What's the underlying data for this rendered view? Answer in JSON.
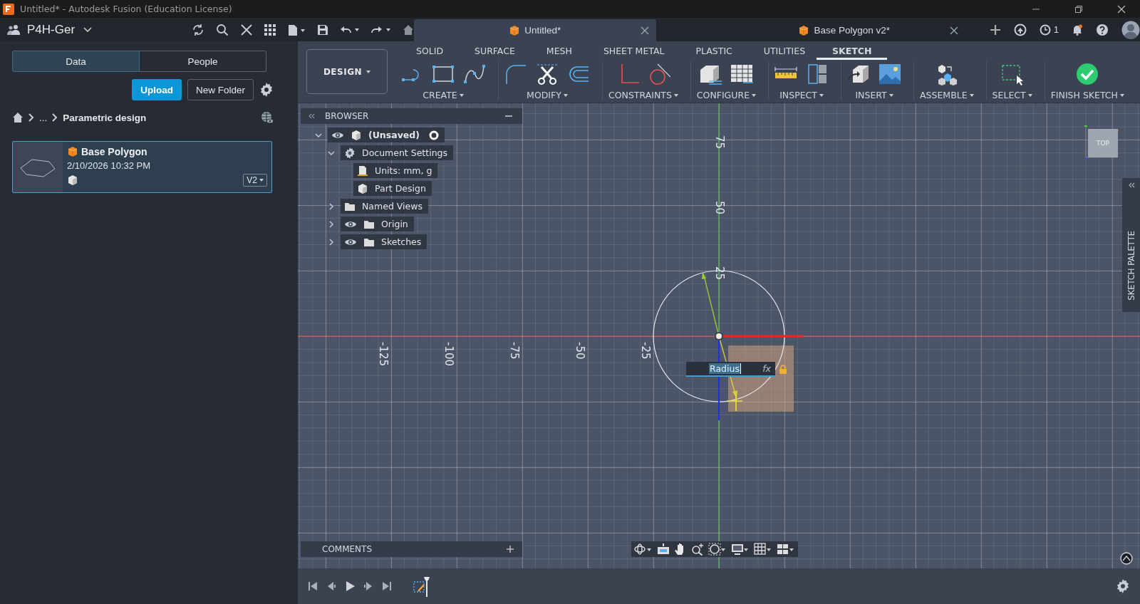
{
  "window": {
    "title": "Untitled* - Autodesk Fusion (Education License)"
  },
  "team": {
    "name": "P4H-Ger"
  },
  "panel_tabs": [
    {
      "label": "Data",
      "selected": true
    },
    {
      "label": "People",
      "selected": false
    }
  ],
  "panel_buttons": {
    "upload": "Upload",
    "new_folder": "New Folder"
  },
  "breadcrumb": {
    "ellipsis": "...",
    "current": "Parametric design"
  },
  "files": [
    {
      "name": "Base Polygon",
      "date": "2/10/2026 10:32 PM",
      "version": "V2",
      "selected": true
    }
  ],
  "document_tabs": [
    {
      "label": "Untitled*",
      "selected": true
    },
    {
      "label": "Base Polygon v2*",
      "selected": false
    }
  ],
  "job_status": {
    "count": "1"
  },
  "workspace": {
    "label": "DESIGN"
  },
  "toolbar_tabs": [
    {
      "label": "SOLID",
      "selected": false
    },
    {
      "label": "SURFACE",
      "selected": false
    },
    {
      "label": "MESH",
      "selected": false
    },
    {
      "label": "SHEET METAL",
      "selected": false
    },
    {
      "label": "PLASTIC",
      "selected": false
    },
    {
      "label": "UTILITIES",
      "selected": false
    },
    {
      "label": "SKETCH",
      "selected": true
    }
  ],
  "tool_groups": [
    {
      "label": "CREATE"
    },
    {
      "label": "MODIFY"
    },
    {
      "label": "CONSTRAINTS"
    },
    {
      "label": "CONFIGURE"
    },
    {
      "label": "INSPECT"
    },
    {
      "label": "INSERT"
    },
    {
      "label": "ASSEMBLE"
    },
    {
      "label": "SELECT"
    },
    {
      "label": "FINISH SKETCH"
    }
  ],
  "browser": {
    "title": "BROWSER",
    "tree": [
      {
        "label": "(Unsaved)",
        "kind": "component",
        "visible": true,
        "active": true,
        "expanded": true,
        "children": [
          {
            "label": "Document Settings",
            "kind": "settings",
            "expanded": true,
            "children": [
              {
                "label": "Units: mm, g",
                "kind": "units"
              },
              {
                "label": "Part Design",
                "kind": "design"
              }
            ]
          },
          {
            "label": "Named Views",
            "kind": "folder",
            "expanded": false
          },
          {
            "label": "Origin",
            "kind": "folder",
            "visible": true,
            "expanded": false
          },
          {
            "label": "Sketches",
            "kind": "folder",
            "visible": true,
            "expanded": false
          }
        ]
      }
    ]
  },
  "axis_labels": {
    "vertical": [
      "75",
      "50",
      "25"
    ],
    "horizontal": [
      "-125",
      "-100",
      "-75",
      "-50",
      "-25"
    ]
  },
  "dimension_input": {
    "value": "Radius",
    "formula": "fx"
  },
  "view_cube": {
    "face": "TOP"
  },
  "sketch_palette": {
    "title": "SKETCH PALETTE"
  },
  "comments": {
    "title": "COMMENTS"
  }
}
